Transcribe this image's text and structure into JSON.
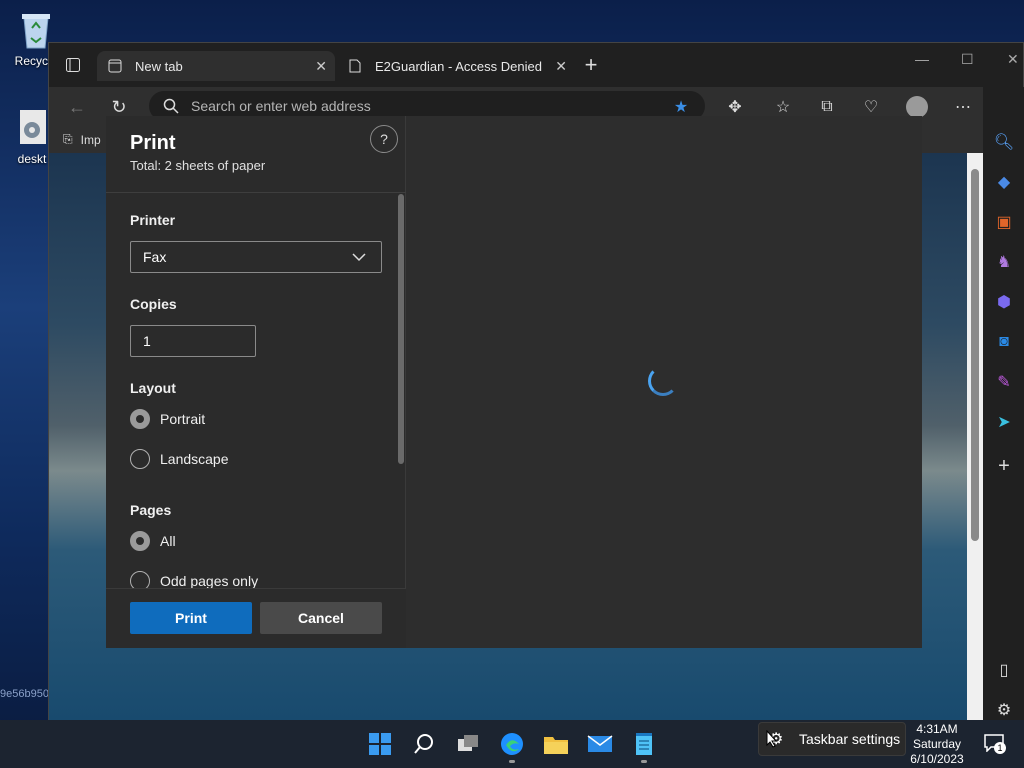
{
  "desktop": {
    "recycle_label": "Recycle",
    "desktop_label": "deskt",
    "hash_text": "9e56b950"
  },
  "browser": {
    "tabs": [
      {
        "label": "New tab",
        "active": true
      },
      {
        "label": "E2Guardian - Access Denied",
        "active": false
      }
    ],
    "address_placeholder": "Search or enter web address",
    "favorites_item": "Imp"
  },
  "print_dialog": {
    "title": "Print",
    "total": "Total: 2 sheets of paper",
    "help": "?",
    "printer_label": "Printer",
    "printer_value": "Fax",
    "copies_label": "Copies",
    "copies_value": "1",
    "layout_label": "Layout",
    "layout_options": [
      {
        "label": "Portrait",
        "selected": true
      },
      {
        "label": "Landscape",
        "selected": false
      }
    ],
    "pages_label": "Pages",
    "pages_options": [
      {
        "label": "All",
        "selected": true
      },
      {
        "label": "Odd pages only",
        "selected": false
      }
    ],
    "print_button": "Print",
    "cancel_button": "Cancel"
  },
  "taskbar": {
    "settings_popup": "Taskbar settings",
    "time": "4:31AM",
    "day": "Saturday",
    "date": "6/10/2023",
    "notification_count": "1"
  },
  "colors": {
    "accent": "#0f6cbd",
    "edge_blue": "#1e90ff"
  }
}
